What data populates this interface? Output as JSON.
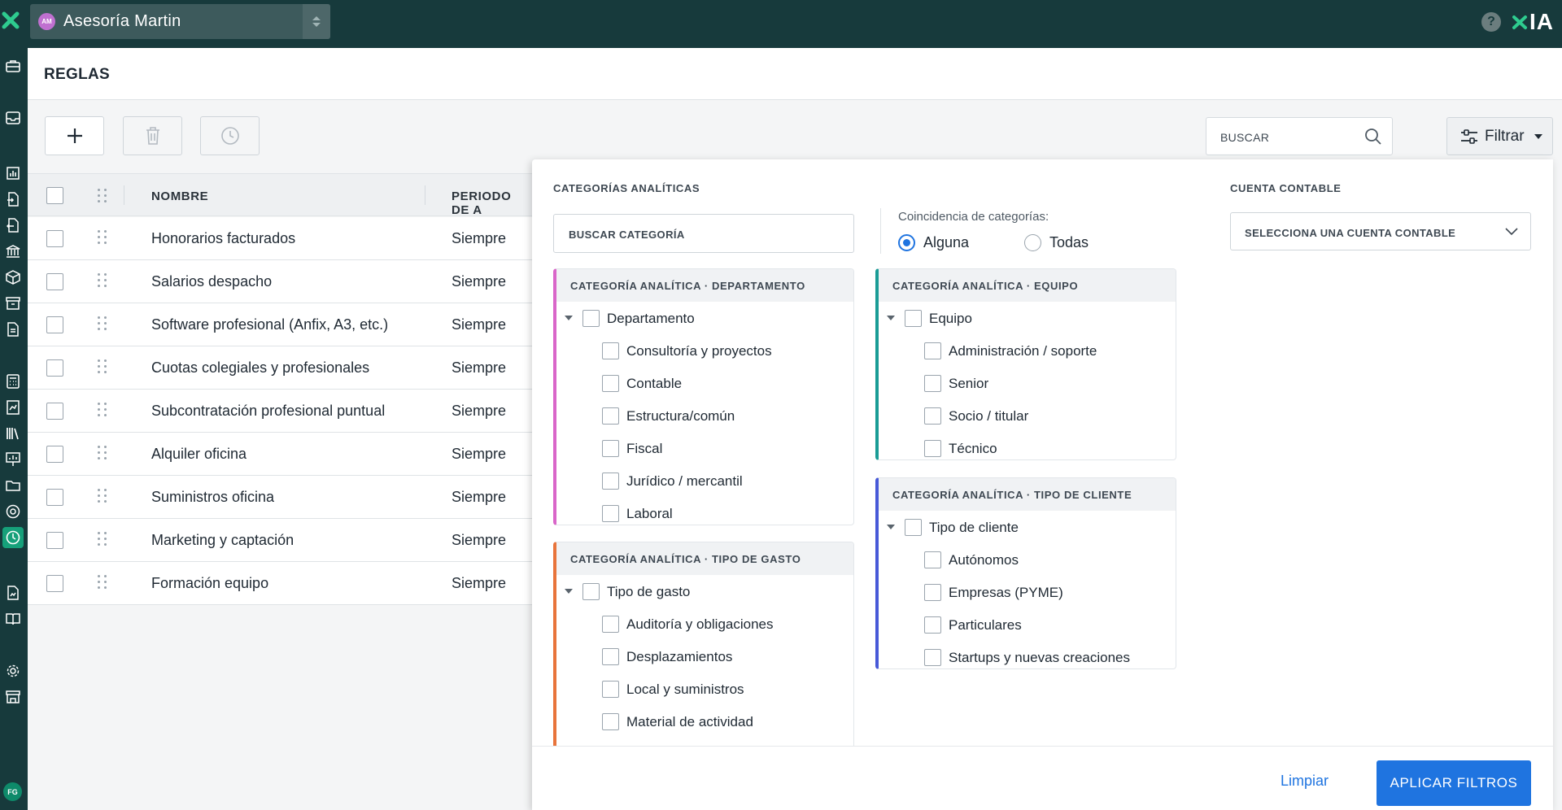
{
  "topbar": {
    "company_initials": "AM",
    "company_name": "Asesoría Martin",
    "brand_label": "IA"
  },
  "sidebar": {
    "user_initials": "FG",
    "icons": [
      "briefcase-icon",
      "inbox-icon",
      "chart-icon",
      "documents-in-icon",
      "documents-out-icon",
      "bank-icon",
      "box-icon",
      "archive-icon",
      "file-icon",
      "calculator-icon",
      "report-icon",
      "books-icon",
      "presentation-icon",
      "folder-icon",
      "target-icon",
      "clock-icon",
      "file-chart-icon",
      "book-icon",
      "gear-icon",
      "store-icon"
    ],
    "active_icon": "clock-icon"
  },
  "page": {
    "title": "REGLAS"
  },
  "toolbar": {
    "search_placeholder": "BUSCAR",
    "filter_label": "Filtrar"
  },
  "table": {
    "columns": [
      "NOMBRE",
      "PERIODO DE A"
    ],
    "rows": [
      {
        "name": "Honorarios facturados",
        "period": "Siempre"
      },
      {
        "name": "Salarios despacho",
        "period": "Siempre"
      },
      {
        "name": "Software profesional (Anfix, A3, etc.)",
        "period": "Siempre"
      },
      {
        "name": "Cuotas colegiales y profesionales",
        "period": "Siempre"
      },
      {
        "name": "Subcontratación profesional puntual",
        "period": "Siempre"
      },
      {
        "name": "Alquiler oficina",
        "period": "Siempre"
      },
      {
        "name": "Suministros oficina",
        "period": "Siempre"
      },
      {
        "name": "Marketing y captación",
        "period": "Siempre"
      },
      {
        "name": "Formación equipo",
        "period": "Siempre"
      }
    ]
  },
  "filter_panel": {
    "categories_label": "CATEGORÍAS ANALÍTICAS",
    "category_search_placeholder": "BUSCAR CATEGORÍA",
    "match_label": "Coincidencia de categorías:",
    "match_options": [
      "Alguna",
      "Todas"
    ],
    "match_selected": "Alguna",
    "account_label": "CUENTA CONTABLE",
    "account_placeholder": "SELECCIONA UNA CUENTA CONTABLE",
    "groups": {
      "departamento": {
        "title": "CATEGORÍA ANALÍTICA · DEPARTAMENTO",
        "accent": "#d966c9",
        "parent": "Departamento",
        "items": [
          "Consultoría y proyectos",
          "Contable",
          "Estructura/común",
          "Fiscal",
          "Jurídico / mercantil",
          "Laboral"
        ]
      },
      "tipo_gasto": {
        "title": "CATEGORÍA ANALÍTICA · TIPO DE GASTO",
        "accent": "#e8743b",
        "parent": "Tipo de gasto",
        "items": [
          "Auditoría y obligaciones",
          "Desplazamientos",
          "Local y suministros",
          "Material de actividad"
        ]
      },
      "equipo": {
        "title": "CATEGORÍA ANALÍTICA · EQUIPO",
        "accent": "#1a9c96",
        "parent": "Equipo",
        "items": [
          "Administración / soporte",
          "Senior",
          "Socio / titular",
          "Técnico"
        ]
      },
      "tipo_cliente": {
        "title": "CATEGORÍA ANALÍTICA · TIPO DE CLIENTE",
        "accent": "#4759d8",
        "parent": "Tipo de cliente",
        "items": [
          "Autónomos",
          "Empresas (PYME)",
          "Particulares",
          "Startups y nuevas creaciones"
        ]
      }
    },
    "clear_label": "Limpiar",
    "apply_label": "APLICAR FILTROS",
    "primary_color": "#1f74e0"
  }
}
